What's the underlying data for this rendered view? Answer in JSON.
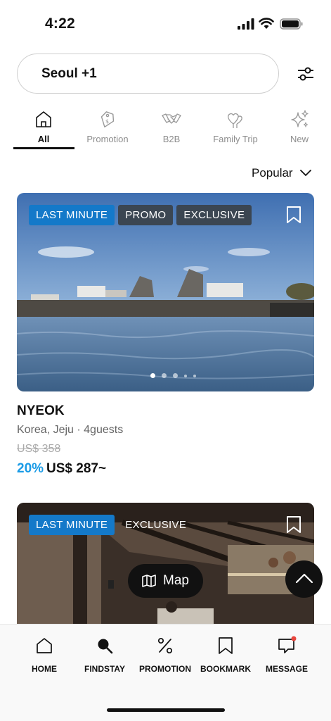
{
  "status": {
    "time": "4:22"
  },
  "search": {
    "value": "Seoul +1"
  },
  "icons": {
    "filter": "sliders-icon",
    "sort_chevron": "chevron-down-icon",
    "bookmark": "bookmark-icon",
    "map": "map-icon",
    "scroll_top": "chevron-up-icon"
  },
  "categories": [
    {
      "label": "All",
      "icon": "home-icon",
      "active": true
    },
    {
      "label": "Promotion",
      "icon": "tag-icon"
    },
    {
      "label": "B2B",
      "icon": "handshake-icon"
    },
    {
      "label": "Family Trip",
      "icon": "hearts-icon"
    },
    {
      "label": "New",
      "icon": "sparkle-icon"
    }
  ],
  "sort": {
    "label": "Popular"
  },
  "listings": [
    {
      "badges": [
        "LAST MINUTE",
        "PROMO",
        "EXCLUSIVE"
      ],
      "name": "NYEOK",
      "location": "Korea, Jeju · 4guests",
      "original_price": "US$ 358",
      "discount": "20%",
      "price": "US$ 287~"
    },
    {
      "badges": [
        "LAST MINUTE",
        "EXCLUSIVE"
      ]
    }
  ],
  "map_button": {
    "label": "Map"
  },
  "bottom_nav": [
    {
      "label": "HOME",
      "icon": "home-icon"
    },
    {
      "label": "FINDSTAY",
      "icon": "search-icon"
    },
    {
      "label": "PROMOTION",
      "icon": "percent-icon"
    },
    {
      "label": "BOOKMARK",
      "icon": "bookmark-icon"
    },
    {
      "label": "MESSAGE",
      "icon": "message-icon",
      "has_notification": true
    }
  ],
  "colors": {
    "accent": "#1a9be6",
    "badge_blue": "#1479c9",
    "badge_dark": "#3b4652",
    "notification": "#e8453c"
  }
}
